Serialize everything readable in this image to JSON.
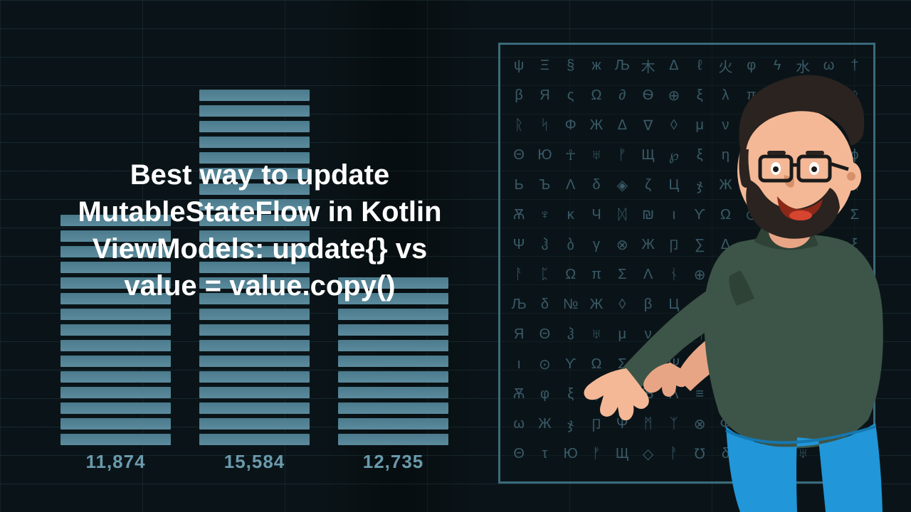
{
  "title": "Best way to update MutableStateFlow in Kotlin ViewModels: update{} vs value = value.copy()",
  "bars": [
    {
      "label": "11,874",
      "segments": 15
    },
    {
      "label": "15,584",
      "segments": 23
    },
    {
      "label": "12,735",
      "segments": 11
    }
  ],
  "glyphRows": [
    "ψΞ§жЉ木Δℓ火φϟ水ω†",
    "βЯςΩ∂Ѳ⊕ξλπΣчØᛟ",
    "ᚱᛋΦЖΔ∇◊μν石Љτღᚦ",
    "ΘЮ☥♅ᚠЩ℘ξη≡⊗风Ψϕ",
    "ЬЪΛδ◈ζЦჯЖᛉχᛗΞᚢ",
    "Ѫ♆κЧᛞ₪ιϒΩ⊙ςЯ℧Σ",
    "Ψჰბγ⊗Ж卩∑Δ◇φЮτξ",
    "ᚨᛈΩπΣΛᚾ⊕Ѳ℞ЩζЬΦ",
    "Љδ№Ж◊βЦηᛟ∂κ☥Ξჯ",
    "ЯΘჰ♅μνᚱᛋ石λЧχᛞτ",
    "ι⊙ϒΩΣ₪Ψπბ∑γ∇ᚦ风",
    "Ѫφξ◈ЬЪΛ≡ζ火Δ水℘木",
    "ωЖჯ卩Ψᛗᛉ⊗Φ♆Цς†ϟ",
    "ΘτЮᚠЩ◇ᚨ℧δЯζ♅ξπ"
  ]
}
